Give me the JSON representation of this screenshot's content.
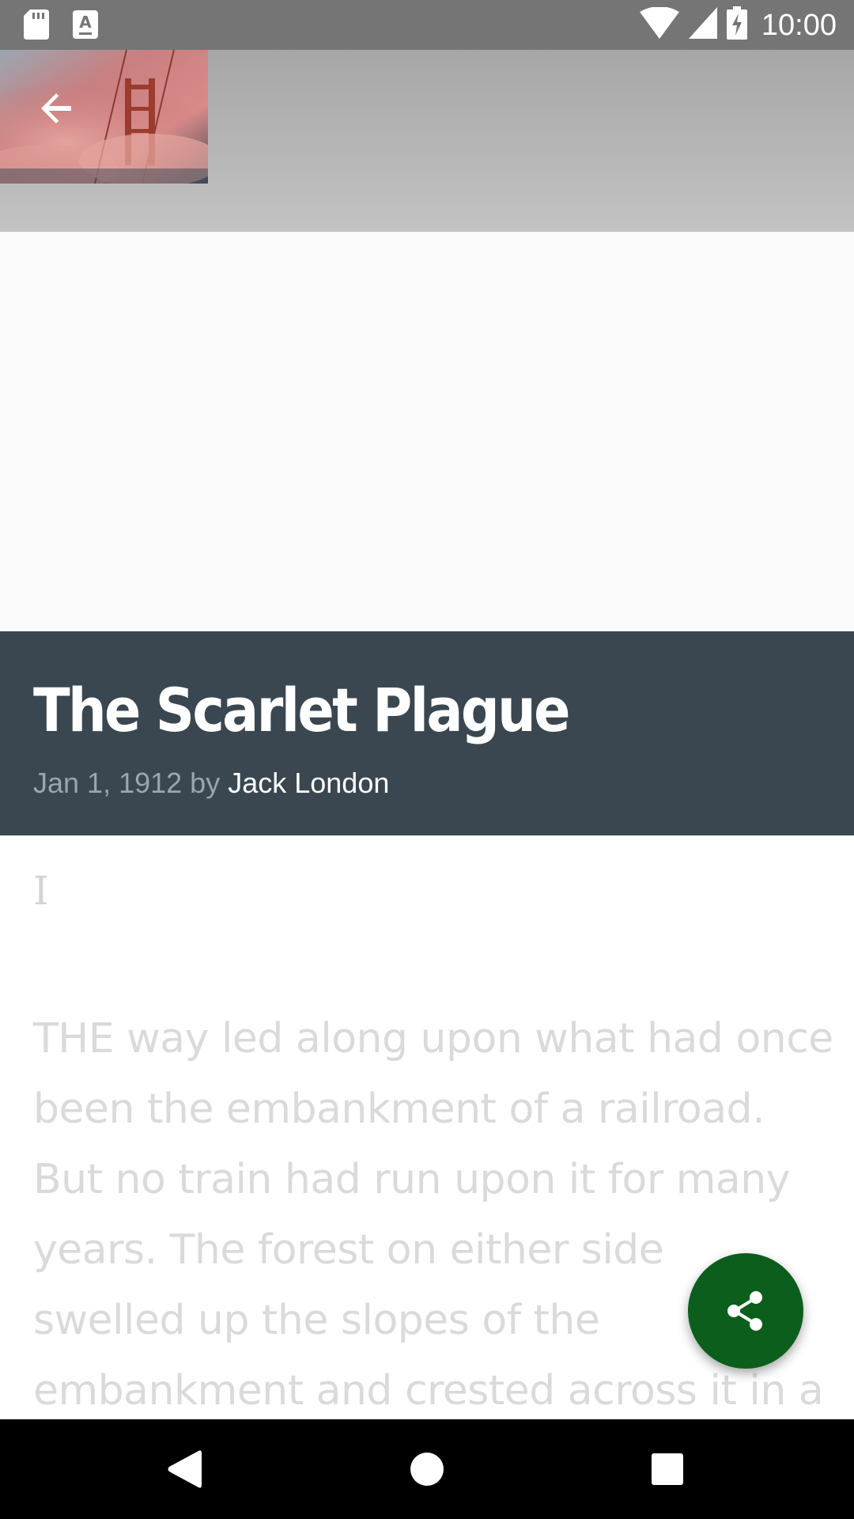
{
  "status_bar": {
    "time": "10:00",
    "icons": [
      "sd-card-icon",
      "font-notification-icon",
      "wifi-icon",
      "cell-signal-icon",
      "battery-charging-icon"
    ]
  },
  "header": {
    "back_icon": "arrow-back-icon",
    "thumbnail": "golden-gate-bridge-fog-image"
  },
  "article": {
    "title": "The Scarlet Plague",
    "date": "Jan 1, 1912",
    "by": "by",
    "author": "Jack London",
    "chapter": "I",
    "body_lines": [
      "THE way led along upon what had once",
      "been the embankment of a railroad.",
      "But no train had run upon it for many",
      "years. The forest on either side",
      "swelled up the slopes of the",
      "embankment and crested across it in a"
    ]
  },
  "fab": {
    "icon": "share-icon",
    "color": "#0b5e1c"
  },
  "colors": {
    "status_bar": "#757575",
    "title_panel": "#3a4750",
    "body_text": "#dadada"
  },
  "nav_bar": {
    "icons": [
      "nav-back-icon",
      "nav-home-icon",
      "nav-recents-icon"
    ]
  }
}
